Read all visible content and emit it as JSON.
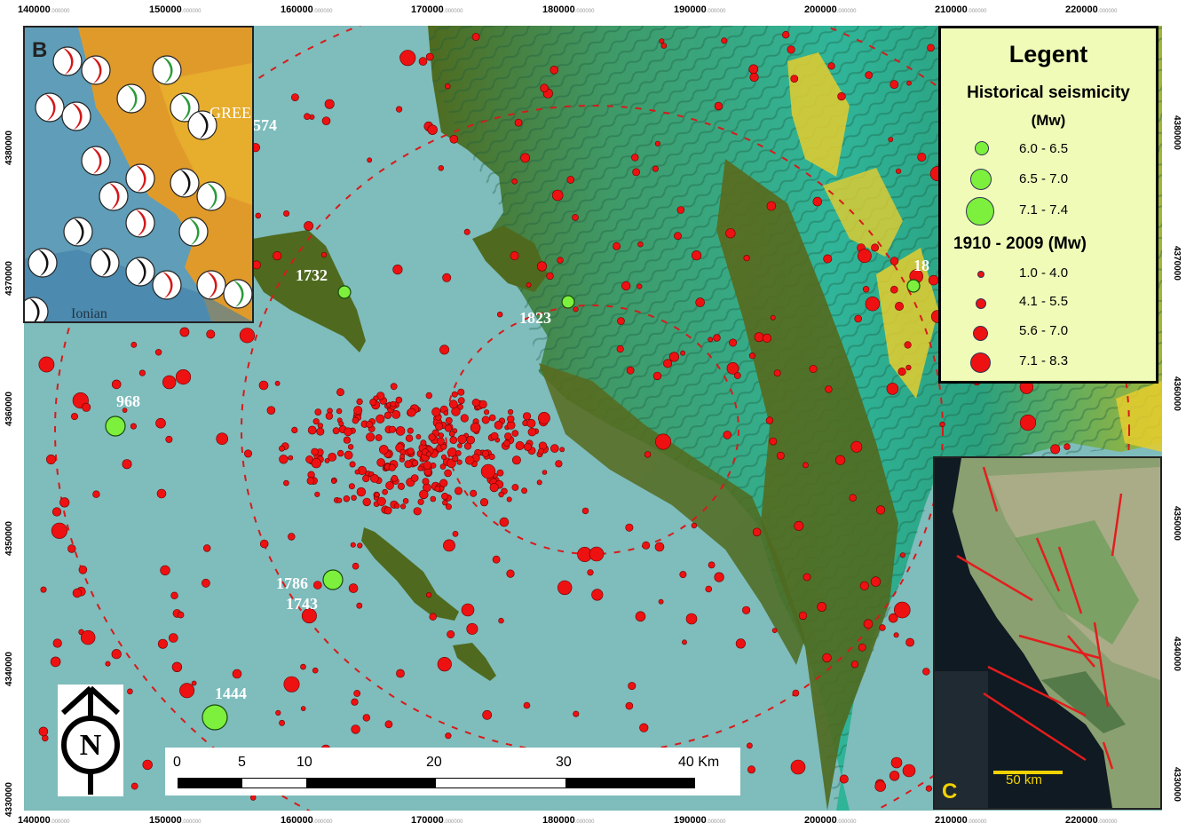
{
  "insets": {
    "b_label": "B",
    "b_place": "GREE",
    "b_sea": "Ionian",
    "c_label": "C",
    "c_scale": "50 km"
  },
  "legend": {
    "title": "Legent",
    "historical_title": "Historical seismicity",
    "historical_unit": "(Mw)",
    "historical_classes": [
      "6.0 - 6.5",
      "6.5 - 7.0",
      "7.1 - 7.4"
    ],
    "instrumental_title": "1910 - 2009 (Mw)",
    "instrumental_classes": [
      "1.0 - 4.0",
      "4.1 - 5.5",
      "5.6 - 7.0",
      "7.1 - 8.3"
    ],
    "historical_color": "#7cf03c",
    "instrumental_color": "#ee1111"
  },
  "event_labels": [
    "968",
    "1444",
    "1732",
    "1823",
    "1786",
    "1743",
    "574",
    "18"
  ],
  "scale_bar": {
    "ticks": [
      "0",
      "5",
      "10",
      "20",
      "30",
      "40 Km"
    ]
  },
  "north_arrow": {
    "letter": "N"
  },
  "axes": {
    "x_ticks": [
      "140000",
      "150000",
      "160000",
      "170000",
      "180000",
      "190000",
      "200000",
      "210000",
      "220000"
    ],
    "x_tick_suffix": ".000000",
    "y_ticks": [
      "4380000",
      "4370000",
      "4360000",
      "4350000",
      "4340000",
      "4330000"
    ],
    "y_tick_suffix": ".000000"
  },
  "colors": {
    "sea": "#7fbcbc",
    "land_low": "#4e6a1e",
    "land_mid": "#36b59a",
    "land_high": "#e8cf2c",
    "dashed_circle": "#d81a1a"
  }
}
